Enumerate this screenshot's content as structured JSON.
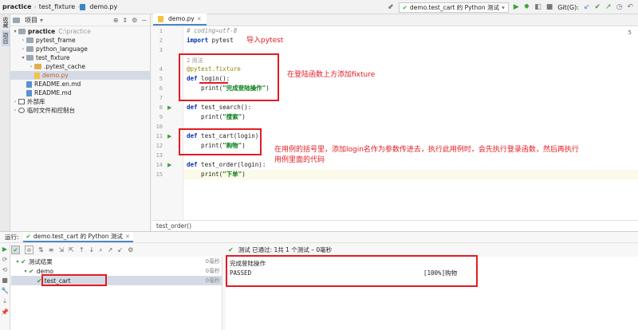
{
  "navbar": {
    "crumbs": [
      "practice",
      "test_fixture",
      "demo.py"
    ],
    "run_config": "demo.test_cart 的 Python 测试",
    "git_label": "Git(G):"
  },
  "stripe": {
    "tab1": "收藏",
    "tab2": "项目"
  },
  "project": {
    "title": "项目",
    "root_name": "practice",
    "root_path": "C:\\practice",
    "items": [
      {
        "label": "pytest_frame"
      },
      {
        "label": "python_language"
      },
      {
        "label": "test_fixture"
      },
      {
        "label": ".pytest_cache"
      },
      {
        "label": "demo.py"
      },
      {
        "label": "README.en.md"
      },
      {
        "label": "README.md"
      },
      {
        "label": "外部库"
      },
      {
        "label": "临时文件和控制台"
      }
    ]
  },
  "editor": {
    "tab_label": "demo.py",
    "line_badge": "5",
    "status": "test_order()",
    "line_numbers": [
      "1",
      "2",
      "3",
      "4",
      "5",
      "6",
      "7",
      "8",
      "9",
      "10",
      "11",
      "12",
      "13",
      "14",
      "15"
    ],
    "code": {
      "l1": "# coding=utf-8",
      "l2_kw": "import",
      "l2_rest": " pytest",
      "l4_hint": "2 用法",
      "l4": "@pytest.fixture",
      "l5_kw": "def",
      "l5_rest": " login():",
      "l6_fn": "    print(",
      "l6_str": "\"完成登陆操作\"",
      "l6_end": ")",
      "l8_kw": "def",
      "l8_rest": " test_search():",
      "l9_fn": "    print(",
      "l9_str": "\"搜索\"",
      "l9_end": ")",
      "l11_kw": "def",
      "l11_rest": " test_cart(login):",
      "l12_fn": "    print(",
      "l12_str": "\"购物\"",
      "l12_end": ")",
      "l14_kw": "def",
      "l14_rest": " test_order(login):",
      "l15_fn": "    print(",
      "l15_str": "\"下单\"",
      "l15_end": ")"
    },
    "annotations": {
      "import": "导入pytest",
      "fixture": "在登陆函数上方添加fixture",
      "usage_line1": "在用例的括号里，添加login名作为参数传进去，执行此用例时，会先执行登录函数，然后再执行",
      "usage_line2": "用例里面的代码"
    }
  },
  "run": {
    "label": "运行:",
    "tab_label": "demo.test_cart 的 Python 测试",
    "status": "测试 已通过: 1共 1 个测试 – 0毫秒",
    "tree": [
      {
        "label": "测试结果",
        "dur": "0毫秒"
      },
      {
        "label": "demo",
        "dur": "0毫秒"
      },
      {
        "label": "test_cart",
        "dur": "0毫秒"
      }
    ],
    "console": {
      "line1": "完成登陆操作",
      "line2_left": "PASSED",
      "line2_right": "[100%]购物"
    }
  }
}
